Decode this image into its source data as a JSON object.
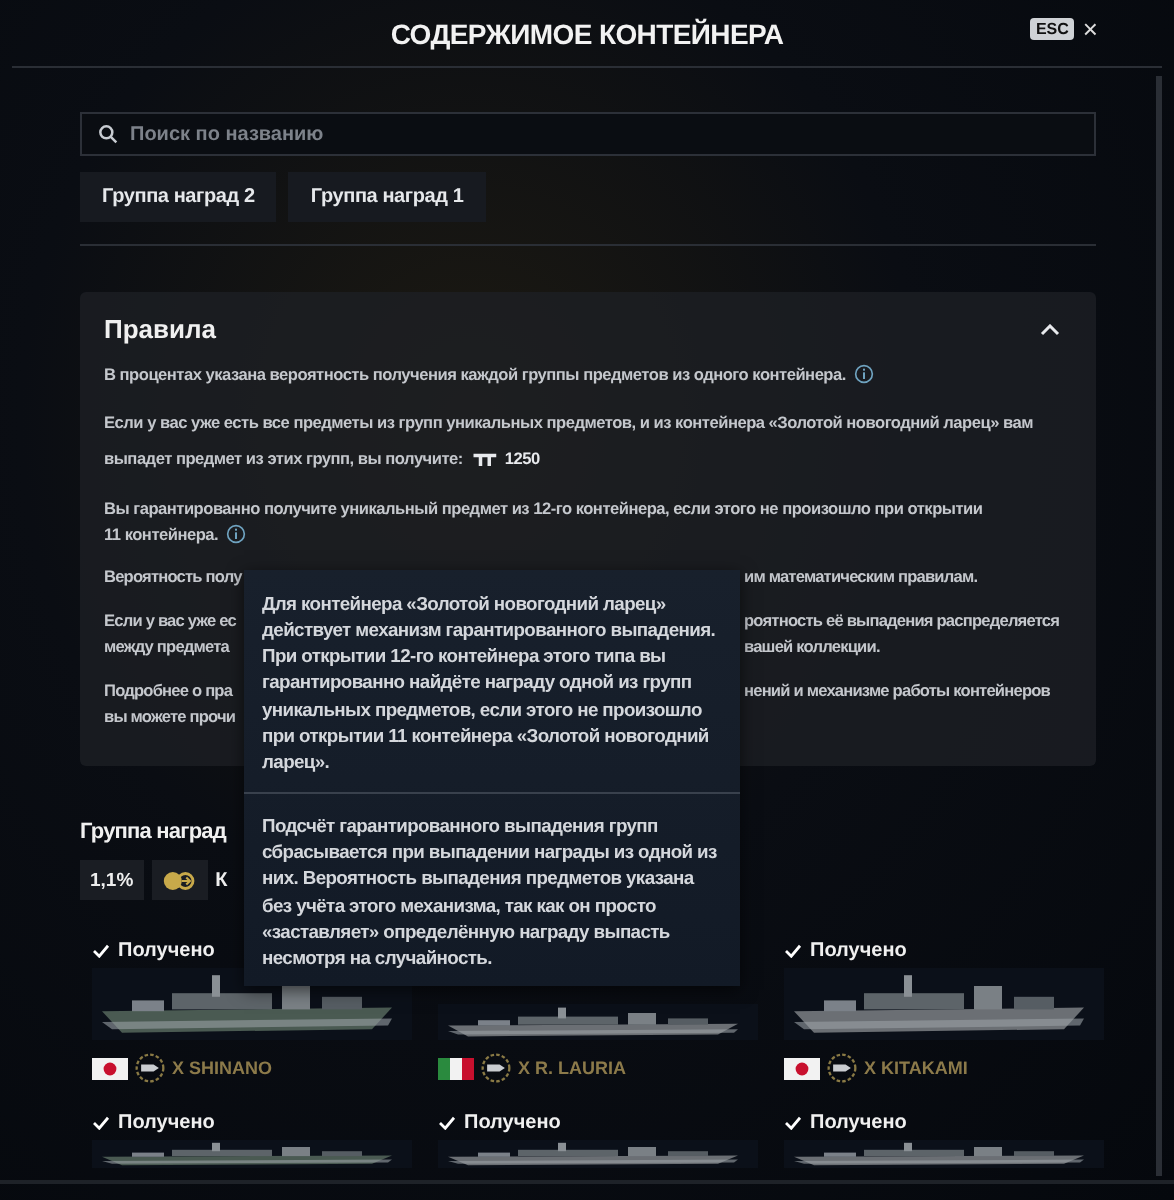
{
  "header": {
    "title": "СОДЕРЖИМОЕ КОНТЕЙНЕРА",
    "esc_key": "ESC",
    "close": "×"
  },
  "search": {
    "placeholder": "Поиск по названию"
  },
  "tabs": [
    {
      "label": "Группа наград 2",
      "selected": false
    },
    {
      "label": "Группа наград 1",
      "selected": false
    }
  ],
  "rules": {
    "title": "Правила",
    "expanded": true,
    "items": [
      {
        "kind": "text",
        "lines": [
          "В процентах указана вероятность получения каждой группы предметов из одного контейнера."
        ],
        "info": true
      },
      {
        "kind": "reward",
        "lines": [
          "Если у вас уже есть все предметы из групп уникальных предметов, и из контейнера «Золотой новогодний ларец» вам",
          "выпадет предмет из этих групп, вы получите:"
        ],
        "amount": "1250"
      },
      {
        "kind": "text",
        "lines": [
          "Вы гарантированно получите уникальный предмет из 12-го контейнера, если этого не произошло при открытии",
          "11 контейнера."
        ],
        "info": true
      },
      {
        "kind": "split",
        "lines": [
          {
            "left": "Вероятность полу",
            "right": "им математическим правилам."
          }
        ]
      },
      {
        "kind": "split",
        "lines": [
          {
            "left": "Если у вас уже ес",
            "right": "роятность её выпадения распределяется"
          },
          {
            "left": "между предмета",
            "right": "вашей коллекции."
          }
        ]
      },
      {
        "kind": "split",
        "lines": [
          {
            "left": "Подробнее о пра",
            "right": "нений и механизме работы контейнеров"
          },
          {
            "left": "вы можете прочи"
          }
        ]
      }
    ]
  },
  "tooltip": {
    "sections": [
      "Для контейнера «Золотой новогодний ларец» действует механизм гарантированного выпадения. При открытии 12-го контейнера этого типа вы гарантированно найдёте награду одной из групп уникальных предметов, если этого не произошло при открытии 11 контейнера «Золотой новогодний ларец».",
      "Подсчёт гарантированного выпадения групп сбрасывается при выпадении награды из одной из них. Вероятность выпадения предметов указана без учёта этого механизма, так как он просто «заставляет» определённую награду выпасть несмотря на случайность."
    ]
  },
  "group": {
    "title": "Группа наград",
    "chance": "1,1%",
    "label": "К"
  },
  "ships": [
    {
      "received_label": "Получено",
      "flag": {
        "kind": "japan"
      },
      "name": "X SHINANO"
    },
    {
      "flag": {
        "kind": "italy"
      },
      "name": "X R. LAURIA"
    },
    {
      "received_label": "Получено",
      "flag": {
        "kind": "japan"
      },
      "name": "X KITAKAMI"
    },
    {
      "received_label": "Получено"
    },
    {
      "received_label": "Получено"
    },
    {
      "received_label": "Получено"
    }
  ]
}
